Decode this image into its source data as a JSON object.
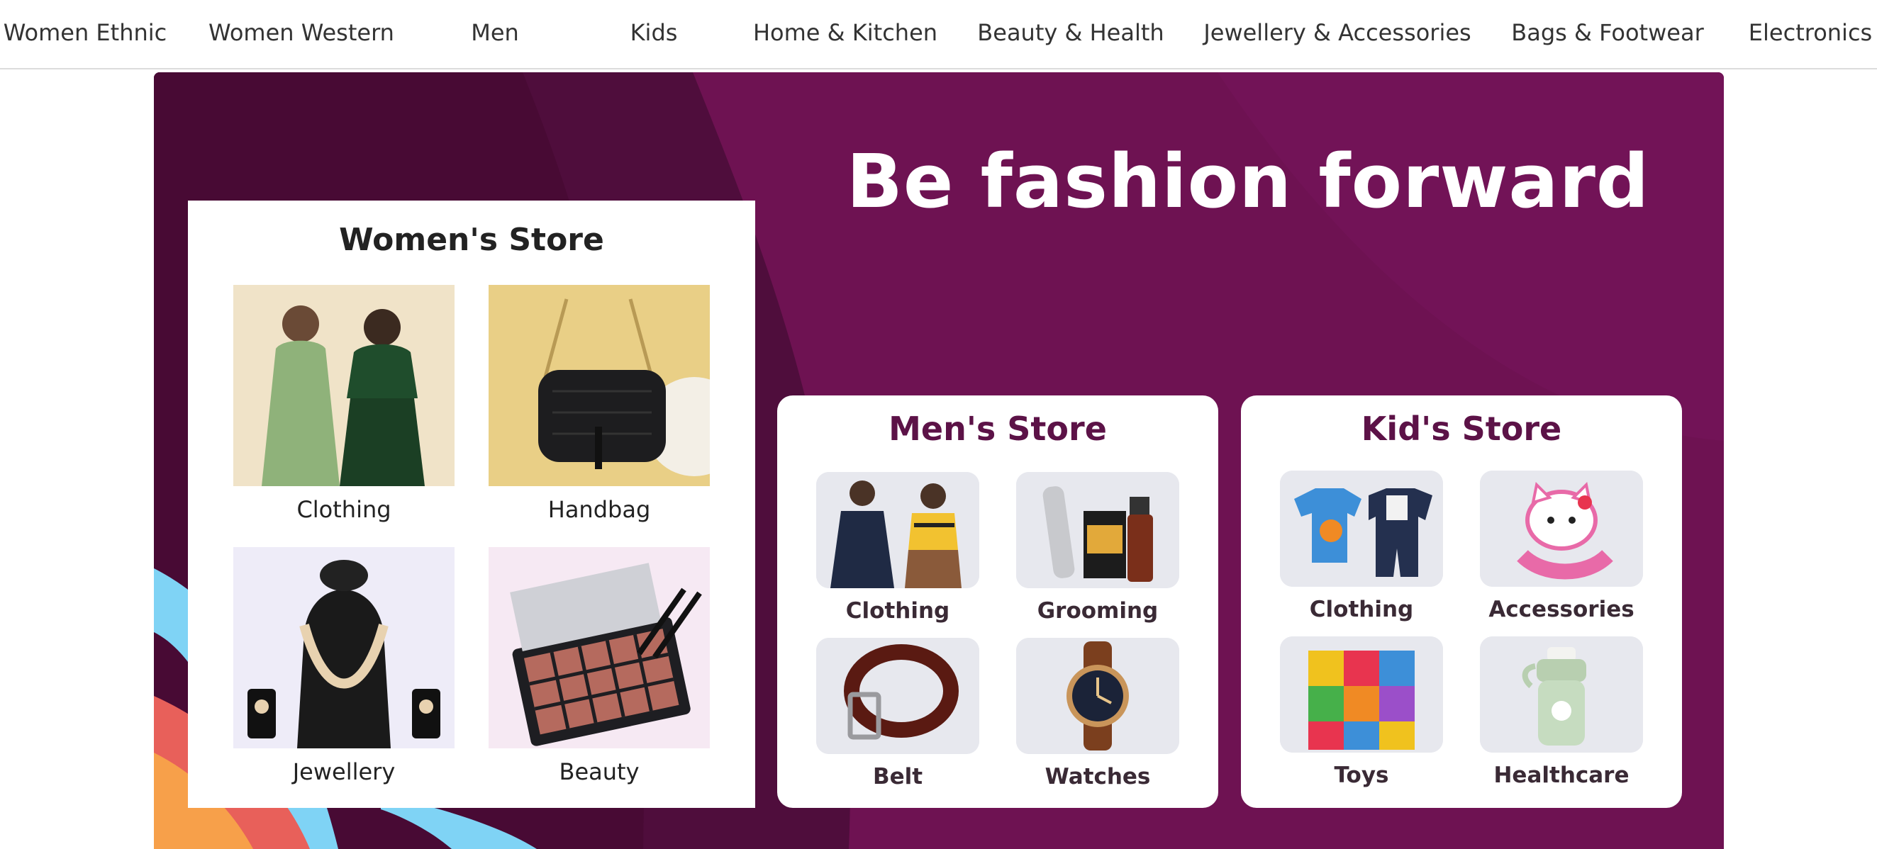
{
  "nav": {
    "items": [
      {
        "label": "Women Ethnic"
      },
      {
        "label": "Women Western"
      },
      {
        "label": "Men"
      },
      {
        "label": "Kids"
      },
      {
        "label": "Home & Kitchen"
      },
      {
        "label": "Beauty & Health"
      },
      {
        "label": "Jewellery & Accessories"
      },
      {
        "label": "Bags & Footwear"
      },
      {
        "label": "Electronics"
      }
    ]
  },
  "banner": {
    "headline": "Be fashion forward",
    "colors": {
      "background": "#6e1252",
      "dark_curve": "#4a0d39",
      "accent_blue": "#7fd3f5",
      "accent_orange": "#f7a04a",
      "accent_red": "#e8605a"
    },
    "womens_store": {
      "title": "Women's Store",
      "tiles": [
        {
          "label": "Clothing",
          "icon": "women-clothing-photo"
        },
        {
          "label": "Handbag",
          "icon": "handbag-photo"
        },
        {
          "label": "Jewellery",
          "icon": "necklace-photo"
        },
        {
          "label": "Beauty",
          "icon": "eyeshadow-palette-photo"
        }
      ]
    },
    "mens_store": {
      "title": "Men's Store",
      "tiles": [
        {
          "label": "Clothing",
          "icon": "men-clothing-photo"
        },
        {
          "label": "Grooming",
          "icon": "trimmer-photo"
        },
        {
          "label": "Belt",
          "icon": "belt-photo"
        },
        {
          "label": "Watches",
          "icon": "watch-photo"
        }
      ]
    },
    "kids_store": {
      "title": "Kid's Store",
      "tiles": [
        {
          "label": "Clothing",
          "icon": "kids-clothing-photo"
        },
        {
          "label": "Accessories",
          "icon": "kids-watch-photo"
        },
        {
          "label": "Toys",
          "icon": "foam-puzzle-photo"
        },
        {
          "label": "Healthcare",
          "icon": "sipper-bottle-photo"
        }
      ]
    }
  }
}
